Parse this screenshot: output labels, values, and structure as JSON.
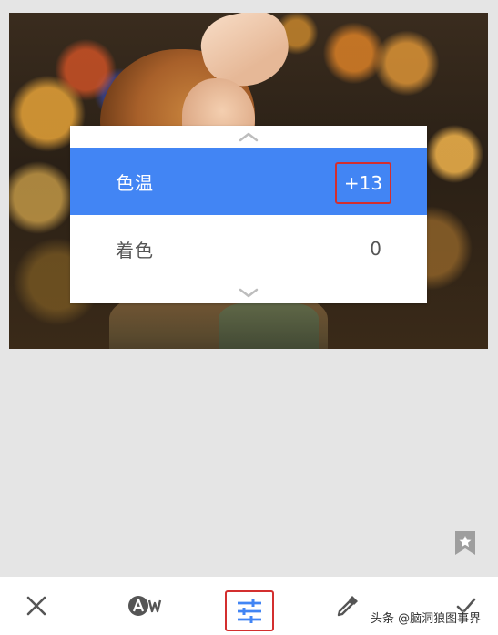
{
  "adjust_menu": {
    "items": [
      {
        "label": "色温",
        "value": "+13",
        "selected": true
      },
      {
        "label": "着色",
        "value": "0",
        "selected": false
      }
    ]
  },
  "toolbar": {
    "icons": [
      "close-icon",
      "styles-icon",
      "tune-icon",
      "color-picker-icon",
      "check-icon"
    ]
  },
  "watermark": {
    "text": "头条 @脑洞狼图事界"
  },
  "colors": {
    "accent": "#4285f4",
    "highlight_border": "#d32f2f",
    "background": "#e5e5e5"
  }
}
